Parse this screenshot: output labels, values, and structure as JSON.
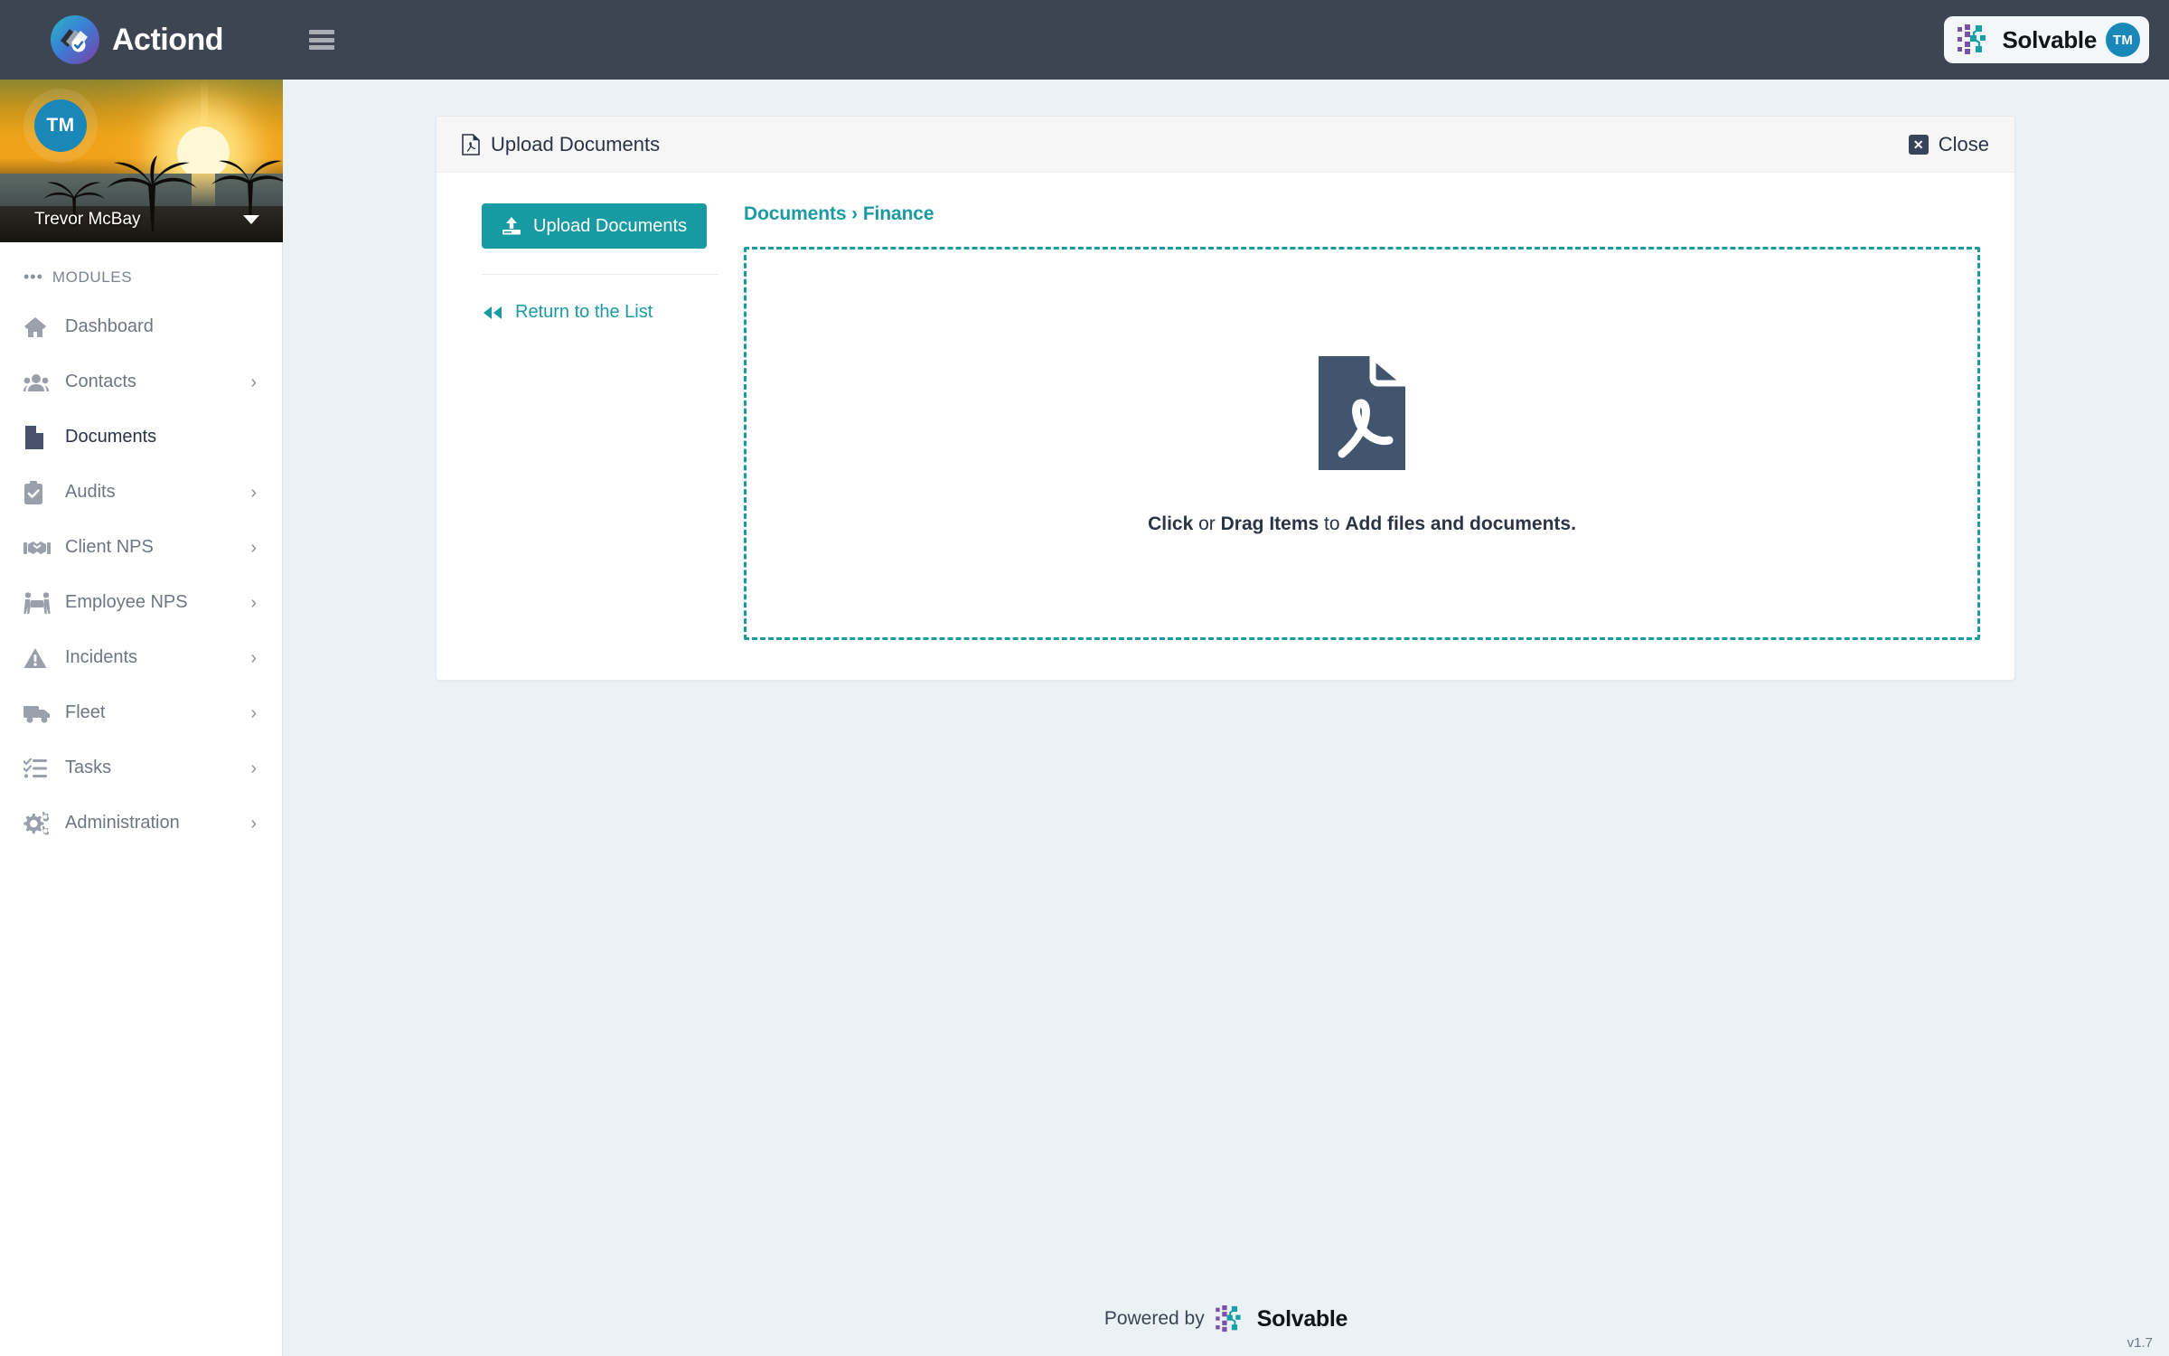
{
  "app": {
    "brand_name": "Actiond",
    "logo_icon": "stacked-pages-check-logo",
    "menu_icon": "hamburger-menu-icon"
  },
  "topbar": {
    "solvable_label": "Solvable",
    "solvable_logo_icon": "solvable-network-logo",
    "user_initials": "TM"
  },
  "sidebar": {
    "profile": {
      "initials": "TM",
      "name": "Trevor McBay",
      "caret_icon": "caret-down-icon",
      "cover_image": "sunset-beach-photo"
    },
    "modules_label": "MODULES",
    "modules_dots": "•••",
    "items": [
      {
        "label": "Dashboard",
        "icon": "home-icon",
        "has_chevron": false,
        "active": false
      },
      {
        "label": "Contacts",
        "icon": "people-icon",
        "has_chevron": true,
        "active": false
      },
      {
        "label": "Documents",
        "icon": "document-icon",
        "has_chevron": false,
        "active": true
      },
      {
        "label": "Audits",
        "icon": "clipboard-check-icon",
        "has_chevron": true,
        "active": false
      },
      {
        "label": "Client NPS",
        "icon": "handshake-icon",
        "has_chevron": true,
        "active": false
      },
      {
        "label": "Employee NPS",
        "icon": "people-carry-icon",
        "has_chevron": true,
        "active": false
      },
      {
        "label": "Incidents",
        "icon": "warning-triangle-icon",
        "has_chevron": true,
        "active": false
      },
      {
        "label": "Fleet",
        "icon": "truck-icon",
        "has_chevron": true,
        "active": false
      },
      {
        "label": "Tasks",
        "icon": "task-list-icon",
        "has_chevron": true,
        "active": false
      },
      {
        "label": "Administration",
        "icon": "gears-icon",
        "has_chevron": true,
        "active": false
      }
    ],
    "chevron_glyph": "›"
  },
  "card": {
    "title": "Upload Documents",
    "title_icon": "pdf-file-icon",
    "close_label": "Close",
    "close_icon": "close-x-icon",
    "upload_button_label": "Upload Documents",
    "upload_button_icon": "upload-icon",
    "return_link_label": "Return to the List",
    "return_link_icon": "double-chevron-left-icon",
    "breadcrumb": "Documents › Finance",
    "dropzone": {
      "icon": "pdf-file-large-icon",
      "hint_click": "Click",
      "hint_or": " or ",
      "hint_drag": "Drag Items",
      "hint_to": " to ",
      "hint_add": "Add files and documents."
    }
  },
  "footer": {
    "powered_by": "Powered by",
    "solvable_label": "Solvable",
    "solvable_logo_icon": "solvable-network-logo",
    "version": "v1.7"
  },
  "colors": {
    "topbar": "#3d4452",
    "accent_teal": "#189aa2",
    "avatar_blue": "#1a87b9",
    "content_bg": "#eaf2f6",
    "pdf_icon": "#41556e",
    "text_dark": "#2b3445"
  }
}
